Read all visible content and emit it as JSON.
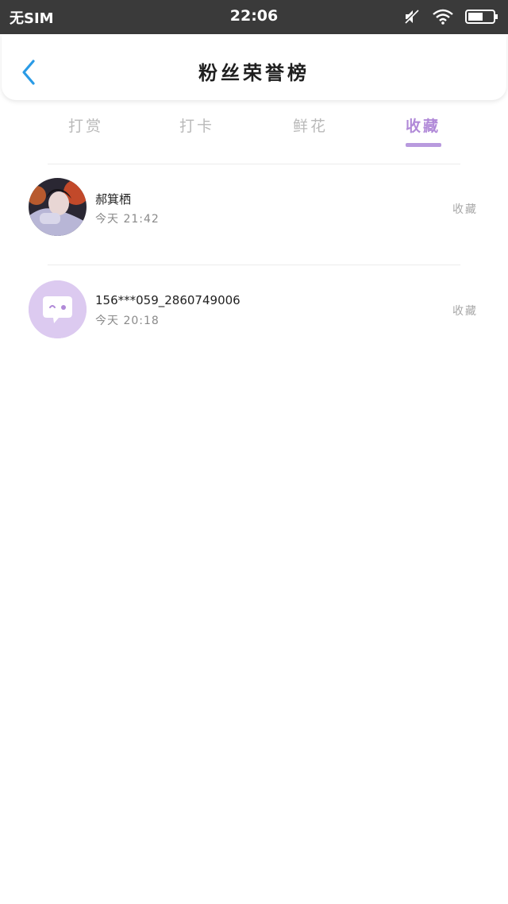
{
  "status_bar": {
    "carrier": "无SIM",
    "time": "22:06",
    "icons": [
      "mute-icon",
      "wifi-icon",
      "battery-icon"
    ]
  },
  "header": {
    "title": "粉丝荣誉榜",
    "back_icon": "chevron-left-icon"
  },
  "tabs": [
    {
      "label": "打赏"
    },
    {
      "label": "打卡"
    },
    {
      "label": "鲜花"
    },
    {
      "label": "收藏",
      "active": true
    }
  ],
  "list": [
    {
      "name": "郝箕栖",
      "time": "今天 21:42",
      "action": "收藏",
      "avatar": "photo-avatar"
    },
    {
      "name": "156***059_2860749006",
      "time": "今天 20:18",
      "action": "收藏",
      "avatar": "default-chat-avatar"
    }
  ],
  "colors": {
    "accent": "#b18ad8",
    "indicator": "#b89ade",
    "back_arrow": "#2a9be6",
    "status_bar": "#3a3a3a",
    "default_avatar": "#dccaf0"
  }
}
